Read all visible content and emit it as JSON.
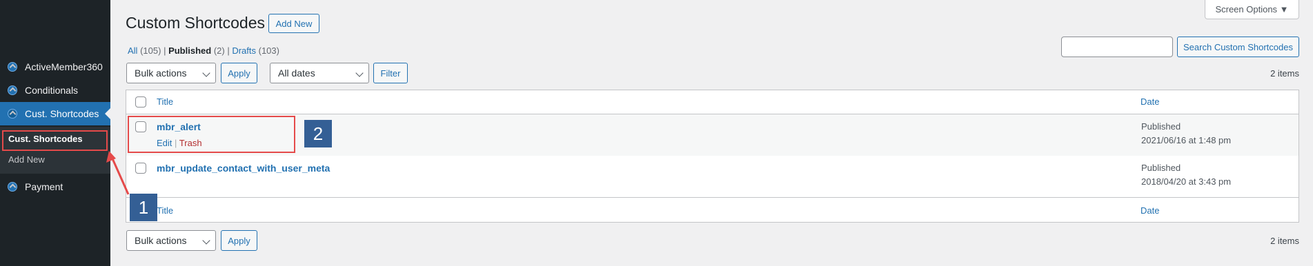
{
  "sidebar": {
    "items": [
      {
        "label": "ActiveMember360",
        "icon": "activemember-icon"
      },
      {
        "label": "Conditionals",
        "icon": "activemember-icon"
      },
      {
        "label": "Cust. Shortcodes",
        "icon": "activemember-icon",
        "active": true
      },
      {
        "label": "Payment",
        "icon": "activemember-icon"
      }
    ],
    "submenu": {
      "current": "Cust. Shortcodes",
      "add_new": "Add New"
    }
  },
  "header": {
    "title": "Custom Shortcodes",
    "add_new": "Add New",
    "screen_options": "Screen Options ▼"
  },
  "filters": {
    "all_label": "All",
    "all_count": "(105)",
    "published_label": "Published",
    "published_count": "(2)",
    "drafts_label": "Drafts",
    "drafts_count": "(103)"
  },
  "search": {
    "placeholder": "",
    "button": "Search Custom Shortcodes"
  },
  "toolbar": {
    "bulk_actions": "Bulk actions",
    "apply": "Apply",
    "dates": "All dates",
    "filter": "Filter",
    "items_count": "2 items"
  },
  "table": {
    "headers": {
      "title": "Title",
      "date": "Date"
    },
    "rows": [
      {
        "title": "mbr_alert",
        "status": "Published",
        "date": "2021/06/16 at 1:48 pm",
        "actions": {
          "edit": "Edit",
          "trash": "Trash"
        }
      },
      {
        "title": "mbr_update_contact_with_user_meta",
        "status": "Published",
        "date": "2018/04/20 at 3:43 pm"
      }
    ]
  },
  "annotations": {
    "badge1": "1",
    "badge2": "2",
    "color": "#e54a4a",
    "badge_color": "#345f95"
  }
}
